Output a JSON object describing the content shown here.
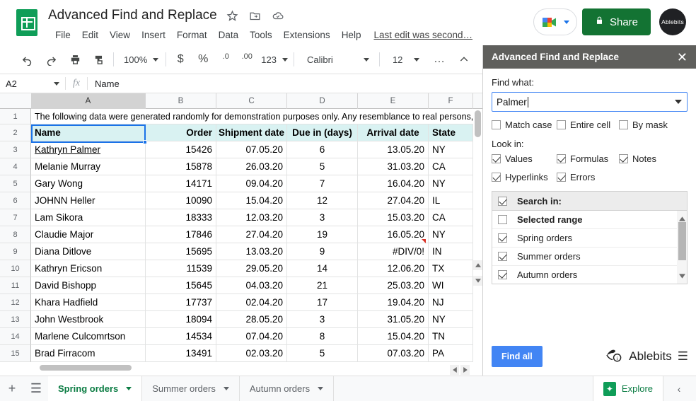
{
  "app": {
    "doc_title": "Advanced Find and Replace",
    "last_edit": "Last edit was second…",
    "menus": [
      "File",
      "Edit",
      "View",
      "Insert",
      "Format",
      "Data",
      "Tools",
      "Extensions",
      "Help"
    ],
    "share_label": "Share",
    "avatar_label": "Ablebits",
    "icons": {
      "star": "star-icon",
      "move": "move-to-folder-icon",
      "cloud": "cloud-saved-icon",
      "meet": "google-meet-icon",
      "lock": "lock-icon"
    }
  },
  "toolbar": {
    "zoom": "100%",
    "currency": "$",
    "percent": "%",
    "dec_decrease": ".0",
    "dec_increase": ".00",
    "number_format": "123",
    "font": "Calibri",
    "font_size": "12",
    "more": "…",
    "collapse": "︿"
  },
  "formula_bar": {
    "name_box": "A2",
    "fx": "fx",
    "content": "Name"
  },
  "grid": {
    "columns": [
      "A",
      "B",
      "C",
      "D",
      "E",
      "F"
    ],
    "selected_column": "A",
    "row_numbers": [
      "1",
      "2",
      "3",
      "4",
      "5",
      "6",
      "7",
      "8",
      "9",
      "10",
      "11",
      "12",
      "13",
      "14",
      "15"
    ],
    "row1_note": "The following data were generated randomly for demonstration purposes only. Any resemblance to real persons, liv",
    "headers": [
      "Name",
      "Order",
      "Shipment date",
      "Due in (days)",
      "Arrival date",
      "State"
    ],
    "rows": [
      [
        "Kathryn Palmer",
        "15426",
        "07.05.20",
        "6",
        "13.05.20",
        "NY"
      ],
      [
        "Melanie Murray",
        "15878",
        "26.03.20",
        "5",
        "31.03.20",
        "CA"
      ],
      [
        "Gary Wong",
        "14171",
        "09.04.20",
        "7",
        "16.04.20",
        "NY"
      ],
      [
        "JOHNN Heller",
        "10090",
        "15.04.20",
        "12",
        "27.04.20",
        "IL"
      ],
      [
        "Lam Sikora",
        "18333",
        "12.03.20",
        "3",
        "15.03.20",
        "CA"
      ],
      [
        "Claudie Major",
        "17846",
        "27.04.20",
        "19",
        "16.05.20",
        "NY"
      ],
      [
        "Diana Ditlove",
        "15695",
        "13.03.20",
        "9",
        "#DIV/0!",
        "IN"
      ],
      [
        "Kathryn Ericson",
        "11539",
        "29.05.20",
        "14",
        "12.06.20",
        "TX"
      ],
      [
        "David Bishopp",
        "15645",
        "04.03.20",
        "21",
        "25.03.20",
        "WI"
      ],
      [
        "Khara Hadfield",
        "17737",
        "02.04.20",
        "17",
        "19.04.20",
        "NJ"
      ],
      [
        "John Westbrook",
        "18094",
        "28.05.20",
        "3",
        "31.05.20",
        "NY"
      ],
      [
        "Marlene Culcomrtson",
        "14534",
        "07.04.20",
        "8",
        "15.04.20",
        "TN"
      ],
      [
        "Brad Firracom",
        "13491",
        "02.03.20",
        "5",
        "07.03.20",
        "PA"
      ]
    ]
  },
  "panel": {
    "title": "Advanced Find and Replace",
    "close": "✕",
    "find_label": "Find what:",
    "find_value": "Palmer",
    "options": [
      {
        "label": "Match case",
        "checked": false
      },
      {
        "label": "Entire cell",
        "checked": false
      },
      {
        "label": "By mask",
        "checked": false
      }
    ],
    "look_in_label": "Look in:",
    "look_in": [
      {
        "label": "Values",
        "checked": true
      },
      {
        "label": "Formulas",
        "checked": true
      },
      {
        "label": "Notes",
        "checked": true
      },
      {
        "label": "Hyperlinks",
        "checked": true
      },
      {
        "label": "Errors",
        "checked": true
      }
    ],
    "search_in_label": "Search in:",
    "search_in_checked": true,
    "search_in_items": [
      {
        "label": "Selected range",
        "checked": false,
        "bold": true
      },
      {
        "label": "Spring orders",
        "checked": true,
        "bold": false
      },
      {
        "label": "Summer orders",
        "checked": true,
        "bold": false
      },
      {
        "label": "Autumn orders",
        "checked": true,
        "bold": false
      }
    ],
    "find_all_label": "Find all",
    "brand": "Ablebits",
    "menu_glyph": "☰"
  },
  "tabs": {
    "add": "+",
    "all_sheets": "☰",
    "sheets": [
      {
        "label": "Spring orders",
        "active": true
      },
      {
        "label": "Summer orders",
        "active": false
      },
      {
        "label": "Autumn orders",
        "active": false
      }
    ],
    "explore": "Explore",
    "collapse": "‹"
  },
  "colors": {
    "brand_green": "#0f9d58",
    "share_green": "#137333",
    "accent_blue": "#4285f4",
    "selection_blue": "#1a73e8",
    "header_fill": "#d9f2f2",
    "panel_header": "#5f5f5c",
    "error_red": "#d93025"
  }
}
